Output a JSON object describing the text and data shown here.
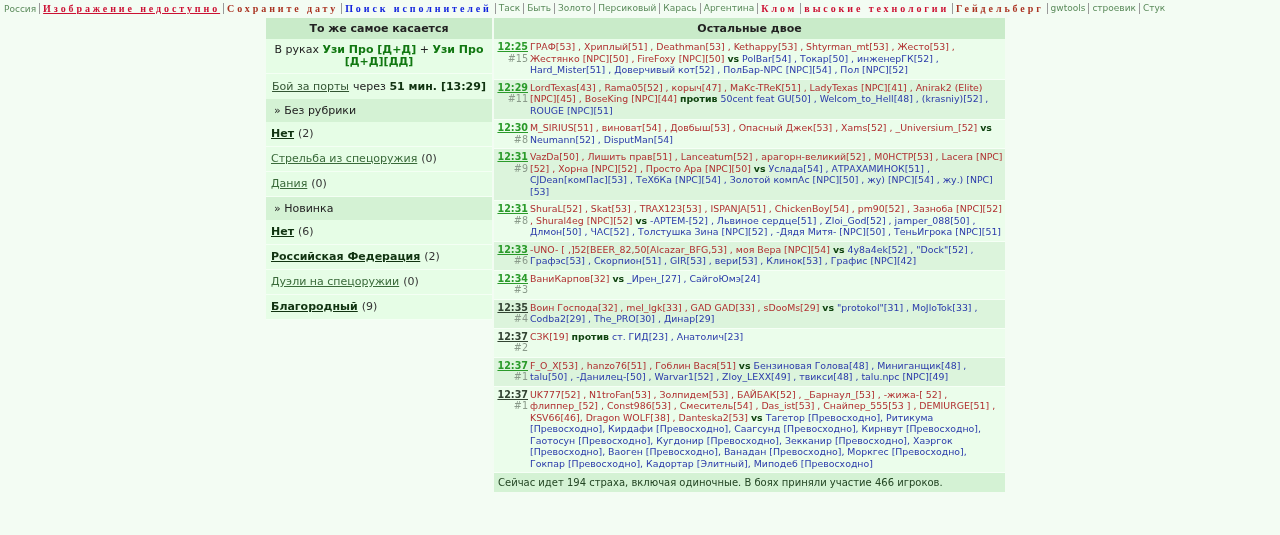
{
  "nav": [
    {
      "label": "Россия",
      "kind": "plain"
    },
    {
      "label": "Изображение недоступно",
      "kind": "spaced",
      "color": "#cc1133",
      "underlined": true
    },
    {
      "label": "Сохраните дату",
      "kind": "spaced",
      "color": "#aa3322",
      "underlined": false
    },
    {
      "label": "Поиск исполнителей",
      "kind": "spaced",
      "color": "#1122dd",
      "underlined": false
    },
    {
      "label": "Таск",
      "kind": "plain"
    },
    {
      "label": "Быть",
      "kind": "plain"
    },
    {
      "label": "Золото",
      "kind": "plain"
    },
    {
      "label": "Персиковый",
      "kind": "plain"
    },
    {
      "label": "Карась",
      "kind": "plain"
    },
    {
      "label": "Аргентина",
      "kind": "plain"
    },
    {
      "label": "Клом",
      "kind": "spaced",
      "color": "#cc1133",
      "underlined": false
    },
    {
      "label": "высокие технологии",
      "kind": "spaced",
      "color": "#cc1133",
      "underlined": false
    },
    {
      "label": "Гейдельберг",
      "kind": "spaced",
      "color": "#aa3322",
      "underlined": false
    },
    {
      "label": "gwtools",
      "kind": "plain"
    },
    {
      "label": "строевик",
      "kind": "plain"
    },
    {
      "label": "Стук",
      "kind": "plain"
    }
  ],
  "left": {
    "title": "То же самое касается",
    "weapon": "В руках **Узи Про [Д+Д]** + **Узи Про [Д+Д][ДД]**",
    "port_link": "Бой за порты",
    "port_time": "через **51 мин. [13:29]**",
    "sections": [
      {
        "header": "» Без рубрики",
        "items": [
          {
            "label": "Нет",
            "count": "(2)",
            "bold": true
          },
          {
            "label": "Стрельба из спецоружия",
            "count": "(0)",
            "bold": false
          },
          {
            "label": "Дания",
            "count": "(0)",
            "bold": false
          }
        ]
      },
      {
        "header": "» Новинка",
        "items": [
          {
            "label": "Нет",
            "count": "(6)",
            "bold": true
          },
          {
            "label": "Российская Федерация",
            "count": "(2)",
            "bold": true
          },
          {
            "label": "Дуэли на спецоружии",
            "count": "(0)",
            "bold": false
          },
          {
            "label": "Благородный",
            "count": "(9)",
            "bold": true
          }
        ]
      }
    ]
  },
  "right": {
    "title": "Остальные двое",
    "battles": [
      {
        "time": "12:25",
        "number": "#15",
        "visited": false,
        "team1": "ГРАФ[53] , Хриплый[51] , Deathman[53] , Kethappy[53] , Shtyrman_mt[53] , Жесто[53] , Жестянко [NPC][50] , FireFoxy [NPC][50]",
        "versus": "vs",
        "team2": "PolBar[54] , Токар[50] , инженерГК[52] , Hard_Mister[51] , Доверчивый кот[52] , ПолБар-NPC [NPC][54] , Пол [NPC][52]"
      },
      {
        "time": "12:29",
        "number": "#11",
        "visited": false,
        "team1": "LordTexas[43] , Rama05[52] , корыч[47] , MaKc-TReK[51] , LadyTexas [NPC][41] , Anirak2 (Elite) [NPC][45] , BoseKing [NPC][44]",
        "versus": "против",
        "team2": "50cent feat GU[50] , Welcom_to_Hell[48] , (krasniy)[52] , ROUGE [NPC][51]"
      },
      {
        "time": "12:30",
        "number": "#8",
        "visited": false,
        "team1": "M_SIRIUS[51] , виноват[54] , Довбыш[53] , Опасный Джек[53] , Xams[52] , _Universium_[52]",
        "versus": "vs",
        "team2": "Neumann[52] , DisputMan[54]"
      },
      {
        "time": "12:31",
        "number": "#9",
        "visited": false,
        "team1": "VazDa[50] , Лишить прав[51] , Lanceatum[52] , арагорн-великий[52] , M0НСТР[53] , Lacera [NPC][52] , Хорна [NPC][52] , Просто Ара [NPC][50]",
        "versus": "vs",
        "team2": "Услада[54] , АТРАХАМИНОК[51] , CJDean[комПас][53] , ТеХбКа [NPC][54] , Золотой компАс [NPC][50] , жу) [NPC][54] , жу.) [NPC][53]"
      },
      {
        "time": "12:31",
        "number": "#8",
        "visited": false,
        "team1": "ShuraL[52] , Skat[53] , TRAX123[53] , ISPANJA[51] , ChickenBoy[54] , pm90[52] , Зазноба [NPC][52] , Shural4eg [NPC][52]",
        "versus": "vs",
        "team2": "-АРТЕМ-[52] , Львиное сердце[51] , Zloi_God[52] , jamper_088[50] , Длмон[50] , ЧАС[52] , Толстушка Зина [NPC][52] , -Дядя Митя- [NPC][50] , ТеньИгрока [NPC][51]"
      },
      {
        "time": "12:33",
        "number": "#6",
        "visited": false,
        "team1": "-UNO- [ ,]52[BEER_82,50[Alcazar_BFG,53] , моя Вера [NPC][54]",
        "versus": "vs",
        "team2": "4y8a4ek[52] , \"Dock\"[52] , Графэс[53] , Скорпион[51] , GIR[53] , вери[53] , Клинок[53] , Графис [NPC][42]"
      },
      {
        "time": "12:34",
        "number": "#3",
        "visited": false,
        "team1": "ВаниКарпов[32]",
        "versus": "vs",
        "team2": "_Ирен_[27] , СайгоЮмэ[24]"
      },
      {
        "time": "12:35",
        "number": "#4",
        "visited": true,
        "team1": "Воин Господа[32] , mel_lgk[33] , GAD GAD[33] , sDooMs[29]",
        "versus": "vs",
        "team2": "\"protokol\"[31] , MoJloTok[33] , Codba2[29] , The_PRO[30] , Динар[29]"
      },
      {
        "time": "12:37",
        "number": "#2",
        "visited": true,
        "team1": "СЗК[19]",
        "versus": "против",
        "team2": "ст. ГИД[23] , Анатолич[23]"
      },
      {
        "time": "12:37",
        "number": "#1",
        "visited": false,
        "team1": "F_O_X[53] , hanzo76[51] , Гоблин Вася[51]",
        "versus": "vs",
        "team2": "Бензиновая Голова[48] , Миниганщик[48] , talu[50] , -Данилец-[50] , Warvar1[52] , Zloy_LEXX[49] , твикси[48] , talu.npc [NPC][49]"
      },
      {
        "time": "12:37",
        "number": "#1",
        "visited": true,
        "team1": "UK777[52] , N1troFan[53] , Золпидем[53] , БАЙБАК[52] , _Барнаул_[53] , -жижа-[ 52] , флиппер_[52] , Const986[53] , Смеситель[54] , Das_ist[53] , Снайпер_555[53 ] , DEMIURGE[51] , KSV66[46], Dragon WOLF[38] , Danteska2[53]",
        "versus": "vs",
        "team2": "Тагетор [Превосходно], Ритикума [Превосходно], Кирдафи [Превосходно], Саагсунд [Превосходно], Кирнвут [Превосходно], Гаотосун [Превосходно], Кугдонир [Превосходно], Зекканир [Превосходно], Хаэргок [Превосходно], Ваоген [Превосходно], Ванадан [Превосходно], Моркгес [Превосходно], Гокпар [Превосходно], Кадортар [Элитный], Миподеб [Превосходно]"
      }
    ],
    "footer": "Сейчас идет 194 страха, включая одиночные. В боях приняли участие 466 игроков."
  }
}
